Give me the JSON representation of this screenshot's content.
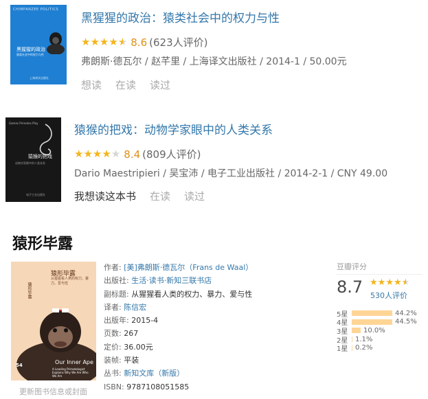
{
  "books": [
    {
      "title": "黑猩猩的政治：猿类社会中的权力与性",
      "score": "8.6",
      "count": "(623人评价)",
      "stars": [
        "on",
        "on",
        "on",
        "on",
        "half"
      ],
      "pub": "弗朗斯·德瓦尔 / 赵芊里 / 上海译文出版社 / 2014-1 / 50.00元",
      "actions": [
        "想读",
        "在读",
        "读过"
      ],
      "cover": {
        "top": "CHIMPANZEE POLITICS",
        "title": "黑猩猩的政治",
        "subtitle": "猿类社会中的权力与性",
        "publisher": "上海译文出版社"
      }
    },
    {
      "title": "猿猴的把戏：动物学家眼中的人类关系",
      "score": "8.4",
      "count": "(809人评价)",
      "stars": [
        "on",
        "on",
        "on",
        "on",
        "off"
      ],
      "pub": "Dario Maestripieri / 吴宝沛 / 电子工业出版社 / 2014-2-1 / CNY 49.00",
      "actions": [
        "我想读这本书",
        "在读",
        "读过"
      ],
      "cover": {
        "top": "Games Primates Play",
        "title": "猿猴的把戏",
        "subtitle": "动物学家眼中的人类关系",
        "publisher": "电子工业出版社"
      }
    }
  ],
  "detail": {
    "heading": "猿形毕露",
    "cover": {
      "title": "猿形毕露",
      "subtitle": "从猩猩看人类的权力、暴力、爱与性",
      "vertical": "猿形毕露",
      "num": "54",
      "en_title": "Our Inner Ape",
      "en_sub": "A Leading Primatologist Explains Why We Are Who We Are"
    },
    "cover_link": "更新图书信息或封面",
    "info": [
      {
        "label": "作者:",
        "value": "[美]弗朗斯·德瓦尔（Frans de Waal）",
        "link": true
      },
      {
        "label": "出版社:",
        "value": "生活·读书·新知三联书店",
        "link": true
      },
      {
        "label": "副标题:",
        "value": "从猩猩看人类的权力、暴力、爱与性",
        "link": false
      },
      {
        "label": "译者:",
        "value": "陈信宏",
        "link": true
      },
      {
        "label": "出版年:",
        "value": "2015-4",
        "link": false
      },
      {
        "label": "页数:",
        "value": "267",
        "link": false
      },
      {
        "label": "定价:",
        "value": "36.00元",
        "link": false
      },
      {
        "label": "装帧:",
        "value": "平装",
        "link": false
      },
      {
        "label": "丛书:",
        "value": "新知文库（新版）",
        "link": true
      },
      {
        "label": "ISBN:",
        "value": "9787108051585",
        "link": false
      }
    ],
    "rating": {
      "header": "豆瓣评分",
      "score": "8.7",
      "stars": [
        "on",
        "on",
        "on",
        "on",
        "half"
      ],
      "count": "530人评价",
      "bars": [
        {
          "label": "5星",
          "percent": 44.2,
          "text": "44.2%"
        },
        {
          "label": "4星",
          "percent": 44.5,
          "text": "44.5%"
        },
        {
          "label": "3星",
          "percent": 10.0,
          "text": "10.0%"
        },
        {
          "label": "2星",
          "percent": 1.1,
          "text": "1.1%"
        },
        {
          "label": "1星",
          "percent": 0.2,
          "text": "0.2%"
        }
      ]
    }
  },
  "colors": {
    "link": "#3377aa",
    "star": "#f4b51b",
    "score": "#e09015",
    "bar": "#ffd596"
  }
}
